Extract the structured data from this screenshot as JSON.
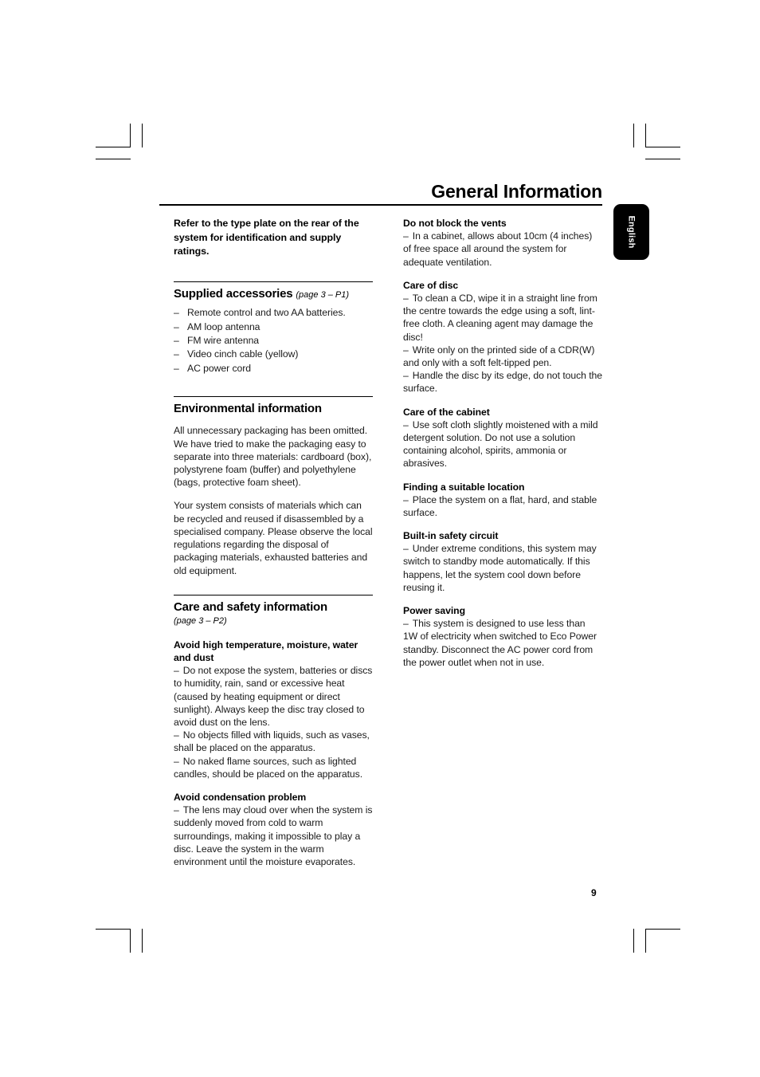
{
  "header": {
    "title": "General Information",
    "language_tab": "English"
  },
  "page_number": "9",
  "left_column": {
    "intro": "Refer to the type plate on the rear of the system for identification and supply ratings.",
    "supplied_accessories": {
      "title": "Supplied accessories",
      "page_ref": "(page 3 – P1)",
      "items": [
        "Remote control and two AA batteries.",
        "AM loop antenna",
        "FM wire antenna",
        "Video cinch cable (yellow)",
        "AC power cord"
      ]
    },
    "environmental_information": {
      "title": "Environmental information",
      "paragraph_1": "All unnecessary packaging has been omitted. We have tried to make the packaging easy to separate into three materials: cardboard (box), polystyrene foam (buffer) and polyethylene (bags, protective foam sheet).",
      "paragraph_2": "Your system consists of materials which can be recycled and reused if disassembled by a specialised company. Please observe the local regulations regarding the disposal of packaging materials, exhausted batteries and old equipment."
    },
    "care_and_safety": {
      "title": "Care and safety information",
      "page_ref": "(page 3 – P2)",
      "avoid_heat": {
        "heading": "Avoid high temperature, moisture, water and dust",
        "item_1": "Do not expose the system, batteries or discs to humidity, rain, sand or excessive heat (caused by heating equipment or direct sunlight). Always keep the disc tray closed to avoid dust on the lens.",
        "item_2": "No objects filled with liquids, such as vases, shall be placed on the apparatus.",
        "item_3": "No naked flame sources, such as lighted candles, should be placed on the apparatus."
      },
      "avoid_condensation": {
        "heading": "Avoid condensation problem",
        "item_1": "The lens may cloud over when the system is suddenly moved from cold to warm surroundings, making it impossible to play a disc. Leave the system in the warm environment until the moisture evaporates."
      }
    }
  },
  "right_column": {
    "do_not_block_vents": {
      "heading": "Do not block the vents",
      "item_1": "In a cabinet, allows about 10cm (4 inches) of free space all around the system for adequate ventilation."
    },
    "care_of_disc": {
      "heading": "Care of disc",
      "item_1": "To clean a CD, wipe it in a straight line from the centre towards the edge using a soft, lint-free cloth.  A cleaning agent may damage the disc!",
      "item_2": "Write only on the printed side of a CDR(W) and only with a soft felt-tipped pen.",
      "item_3": "Handle the disc by its edge, do not touch the surface."
    },
    "care_of_cabinet": {
      "heading": "Care of the cabinet",
      "item_1": "Use soft cloth slightly moistened with a mild detergent solution. Do not use a solution containing alcohol, spirits, ammonia or abrasives."
    },
    "finding_location": {
      "heading": "Finding a suitable location",
      "item_1": "Place the system on a flat, hard, and stable surface."
    },
    "safety_circuit": {
      "heading": "Built-in safety circuit",
      "item_1": "Under extreme conditions,  this system may switch to standby mode automatically.  If this happens, let the system cool down before reusing it."
    },
    "power_saving": {
      "heading": "Power saving",
      "item_1": "This system is designed to use less than 1W of electricity when switched to Eco Power standby.  Disconnect the AC power cord from the power outlet when not in use."
    }
  }
}
